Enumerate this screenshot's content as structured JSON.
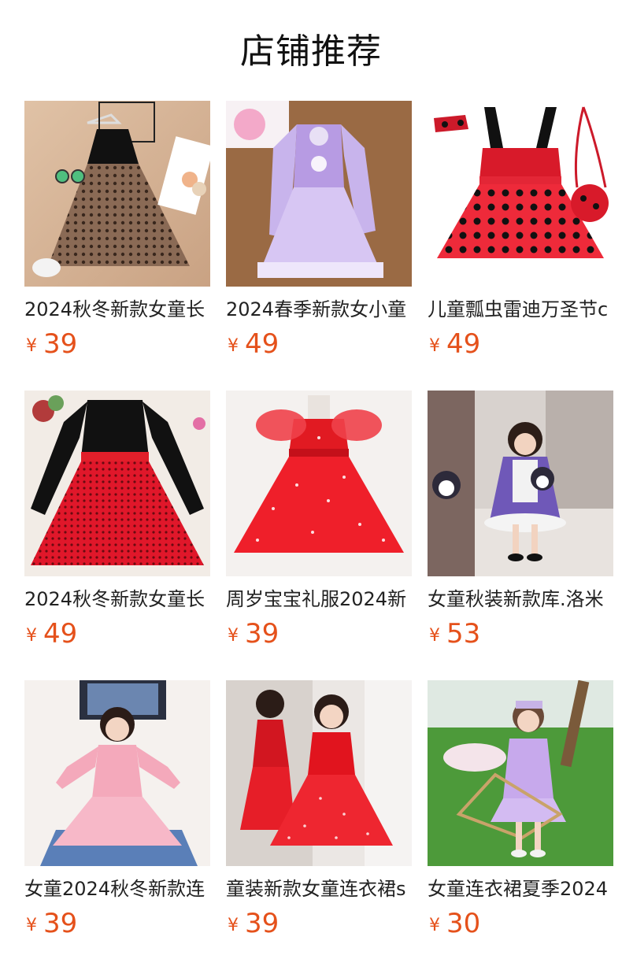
{
  "title": "店铺推荐",
  "currency": "¥",
  "accent_color": "#e5511b",
  "products": [
    {
      "name": "2024秋冬新款女童长",
      "price": "39"
    },
    {
      "name": "2024春季新款女小童",
      "price": "49"
    },
    {
      "name": "儿童瓢虫雷迪万圣节c",
      "price": "49"
    },
    {
      "name": "2024秋冬新款女童长",
      "price": "49"
    },
    {
      "name": "周岁宝宝礼服2024新",
      "price": "39"
    },
    {
      "name": "女童秋装新款库.洛米",
      "price": "53"
    },
    {
      "name": "女童2024秋冬新款连",
      "price": "39"
    },
    {
      "name": "童装新款女童连衣裙s",
      "price": "39"
    },
    {
      "name": "女童连衣裙夏季2024",
      "price": "30"
    }
  ]
}
